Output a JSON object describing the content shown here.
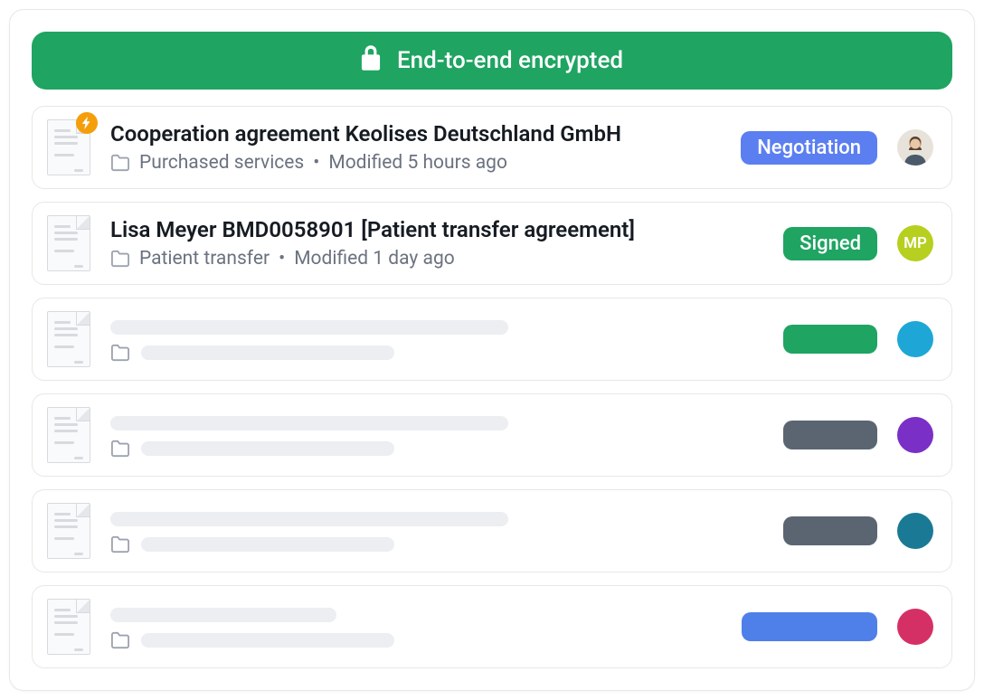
{
  "banner": {
    "text": "End-to-end encrypted"
  },
  "documents": [
    {
      "title": "Cooperation agreement Keolises Deutschland GmbH",
      "folder": "Purchased services",
      "modified": "Modified 5 hours ago",
      "status_label": "Negotiation",
      "status_color": "#5b7ff1",
      "has_bolt": true,
      "avatar_type": "photo",
      "avatar_bg": "#e8e3da",
      "avatar_initials": ""
    },
    {
      "title": "Lisa Meyer BMD0058901 [Patient transfer agreement]",
      "folder": "Patient transfer",
      "modified": "Modified 1 day ago",
      "status_label": "Signed",
      "status_color": "#1fa462",
      "has_bolt": false,
      "avatar_type": "initials",
      "avatar_bg": "#b7cf1f",
      "avatar_initials": "MP"
    }
  ],
  "skeletons": [
    {
      "title_width": 440,
      "meta_width": 280,
      "badge_width": 104,
      "badge_color": "#1fa462",
      "avatar_color": "#1ea7d6"
    },
    {
      "title_width": 440,
      "meta_width": 280,
      "badge_width": 104,
      "badge_color": "#5b6572",
      "avatar_color": "#7a2fc6"
    },
    {
      "title_width": 440,
      "meta_width": 280,
      "badge_width": 104,
      "badge_color": "#5b6572",
      "avatar_color": "#1a7a95"
    },
    {
      "title_width": 250,
      "meta_width": 280,
      "badge_width": 150,
      "badge_color": "#4f7fe8",
      "avatar_color": "#d53065"
    }
  ]
}
